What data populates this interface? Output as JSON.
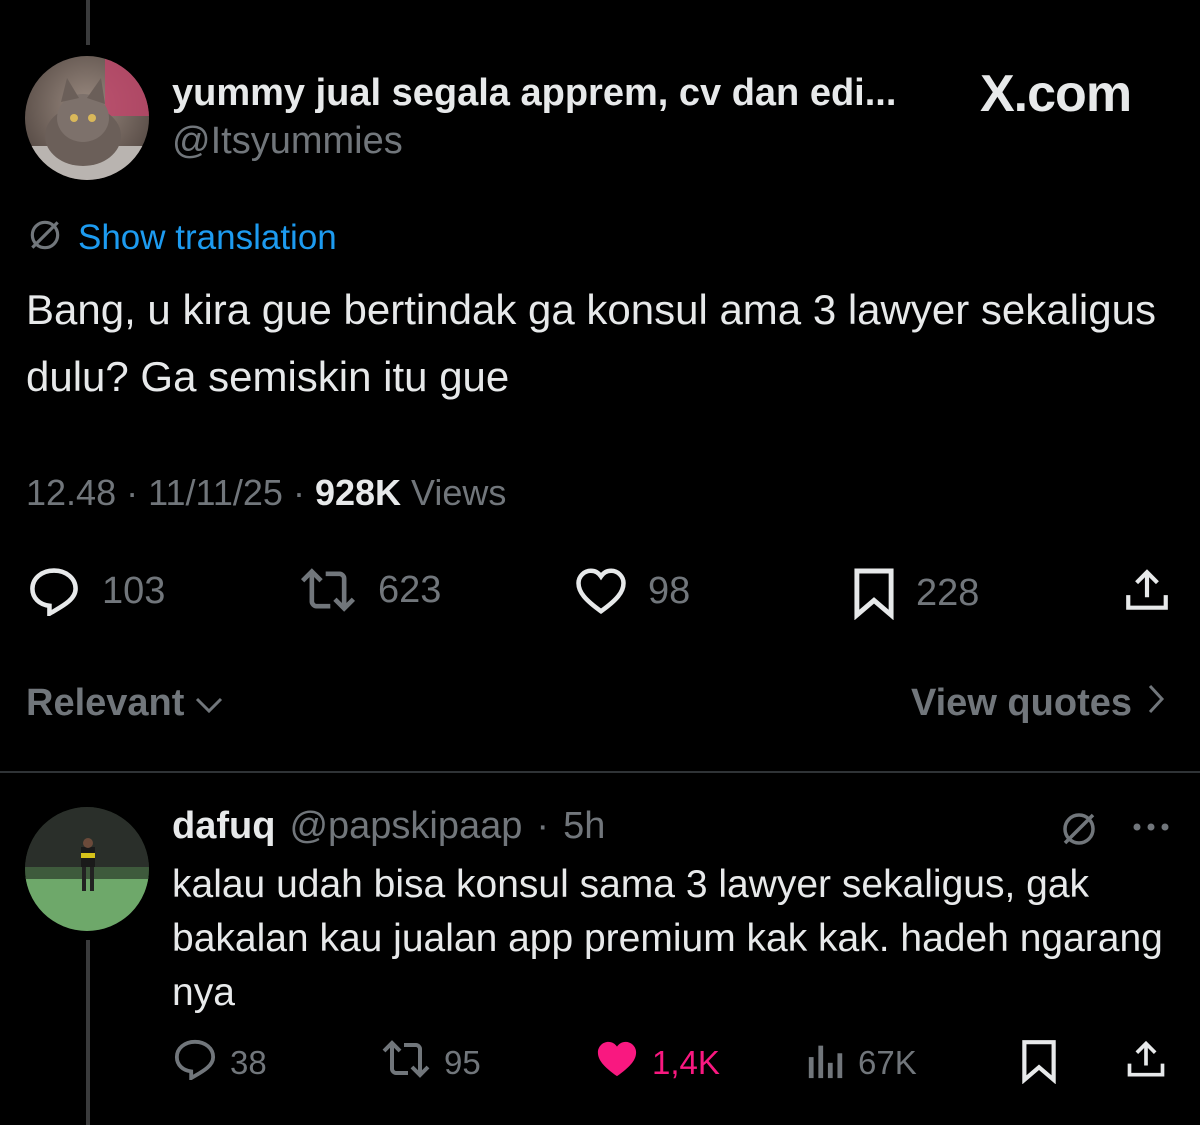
{
  "tweet": {
    "display_name": "yummy jual segala apprem, cv dan edi...",
    "handle": "@Itsyummies",
    "brand": "X.com",
    "show_translation": "Show translation",
    "text": "Bang, u kira gue bertindak ga konsul ama 3 lawyer sekaligus dulu? Ga semiskin itu gue",
    "time": "12.48",
    "date": "11/11/25",
    "views_count": "928K",
    "views_label": "Views",
    "separator": "·",
    "stats": {
      "replies": "103",
      "reposts": "623",
      "likes": "98",
      "bookmarks": "228"
    }
  },
  "controls": {
    "sort_label": "Relevant",
    "view_quotes_label": "View quotes"
  },
  "reply": {
    "display_name": "dafuq",
    "handle": "@papskipaap",
    "separator": "·",
    "age": "5h",
    "text": "kalau udah bisa konsul sama 3 lawyer sekaligus, gak bakalan kau jualan app premium kak kak. hadeh ngarang nya",
    "stats": {
      "replies": "38",
      "reposts": "95",
      "likes": "1,4K",
      "views": "67K"
    }
  },
  "colors": {
    "background": "#000000",
    "text_primary": "#e7e9ea",
    "text_secondary": "#71767b",
    "link": "#1d9bf0",
    "like_active": "#f91880"
  },
  "icons": [
    "translate-globe-icon",
    "reply-icon",
    "repost-icon",
    "like-icon",
    "bookmark-icon",
    "share-icon",
    "chevron-down-icon",
    "chevron-right-icon",
    "more-icon",
    "views-icon"
  ]
}
